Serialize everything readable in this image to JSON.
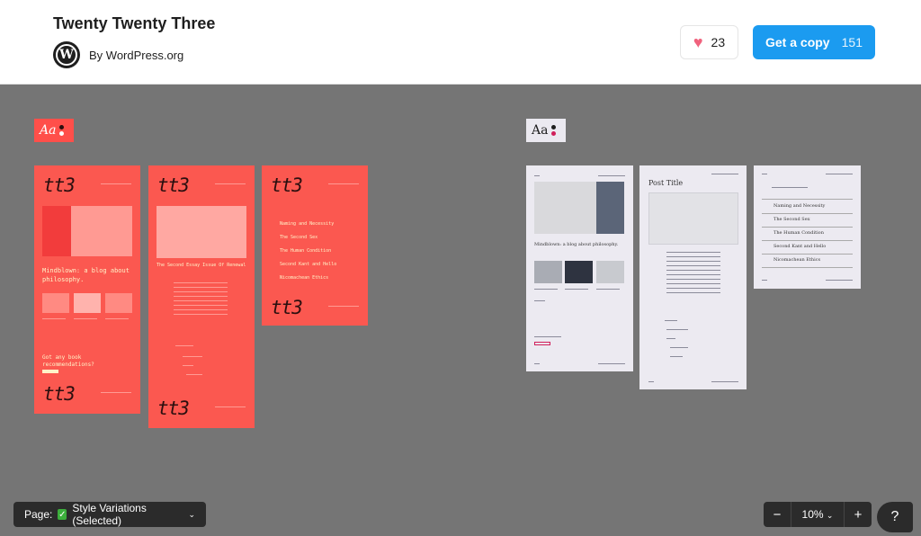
{
  "header": {
    "title": "Twenty Twenty Three",
    "author": "By WordPress.org",
    "logo_letter": "W",
    "likes": "23",
    "copy_label": "Get a copy",
    "copy_count": "151",
    "accent_color": "#1b9bf0",
    "heart_color": "#f0627d"
  },
  "canvas": {
    "background": "#757575",
    "typography_label": "Aa",
    "red_variation": {
      "color": "#fb5850",
      "logo": "tt3",
      "home_heading": "Mindblown: a blog about philosophy.",
      "post_heading": "The Second Essay Issue Of Renewal",
      "cta_text": "Got any book recommendations?",
      "menu_items": [
        "Naming and Necessity",
        "The Second Sex",
        "The Human Condition",
        "Second Kant and Hello",
        "Nicomachean Ethics"
      ]
    },
    "light_variation": {
      "color": "#eceaf1",
      "home_heading": "Mindblown: a blog about philosophy.",
      "post_title": "Post Title",
      "menu_items": [
        "Naming and Necessity",
        "The Second Sex",
        "The Human Condition",
        "Second Kant and Hello",
        "Nicomachean Ethics"
      ]
    }
  },
  "footer": {
    "page_label": "Page:",
    "page_value": "Style Variations (Selected)",
    "zoom_minus": "−",
    "zoom_value": "10%",
    "zoom_plus": "+",
    "help": "?"
  }
}
